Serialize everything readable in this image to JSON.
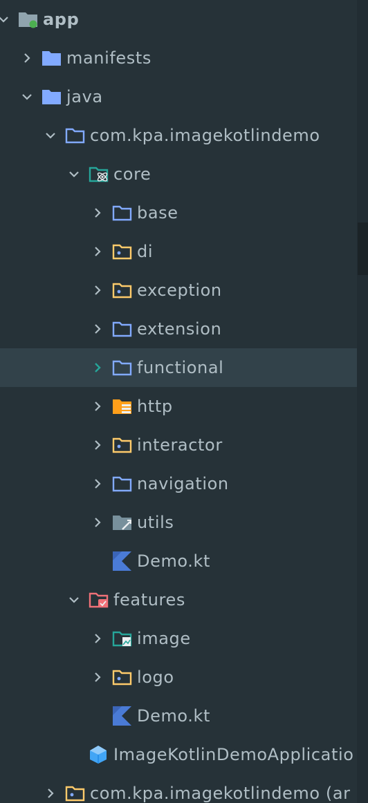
{
  "tree": {
    "rows": [
      {
        "label": "app",
        "icon": "module-folder-icon"
      },
      {
        "label": "manifests",
        "icon": "folder-icon"
      },
      {
        "label": "java",
        "icon": "source-folder-icon"
      },
      {
        "label": "com.kpa.imagekotlindemo",
        "icon": "package-icon"
      },
      {
        "label": "core",
        "icon": "core-package-icon"
      },
      {
        "label": "base",
        "icon": "package-icon"
      },
      {
        "label": "di",
        "icon": "package-icon"
      },
      {
        "label": "exception",
        "icon": "package-icon"
      },
      {
        "label": "extension",
        "icon": "package-icon"
      },
      {
        "label": "functional",
        "icon": "package-icon"
      },
      {
        "label": "http",
        "icon": "http-package-icon"
      },
      {
        "label": "interactor",
        "icon": "package-icon"
      },
      {
        "label": "navigation",
        "icon": "package-icon"
      },
      {
        "label": "utils",
        "icon": "utils-folder-icon"
      },
      {
        "label": "Demo.kt",
        "icon": "kotlin-file-icon"
      },
      {
        "label": "features",
        "icon": "features-package-icon"
      },
      {
        "label": "image",
        "icon": "image-package-icon"
      },
      {
        "label": "logo",
        "icon": "package-icon"
      },
      {
        "label": "Demo.kt",
        "icon": "kotlin-file-icon"
      },
      {
        "label": "ImageKotlinDemoApplicatio",
        "icon": "application-class-icon"
      },
      {
        "label": "com.kpa.imagekotlindemo (ar",
        "icon": "package-icon"
      }
    ],
    "selected_row": "functional"
  },
  "colors": {
    "background": "#263238",
    "selected_row": "#32424a",
    "text": "#b0bec5",
    "folder_blue": "#82aaff",
    "folder_yellow": "#ffcb6b",
    "folder_gray": "#90a4ae",
    "kotlin_blue": "#4a7bd6",
    "features_red": "#f07178",
    "teal": "#26a69a",
    "module_dot_green": "#4caf50",
    "http_orange": "#ff9f1a"
  }
}
